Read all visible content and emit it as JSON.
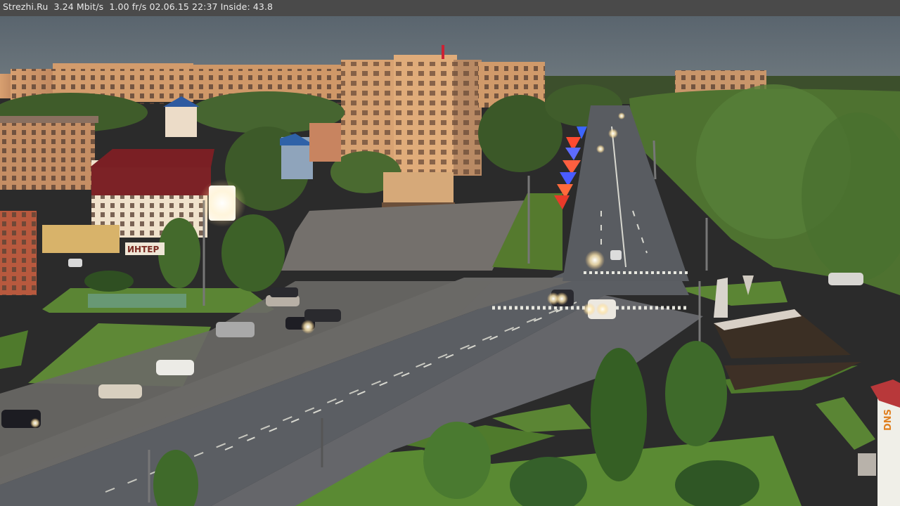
{
  "overlay": {
    "site": "Strezhi.Ru",
    "bitrate": "3.24 Mbit/s",
    "framerate": "1.00 fr/s",
    "datetime": "02.06.15 22:37",
    "inside_label": "Inside:",
    "inside_value": "43.8"
  },
  "signs": {
    "store_sign_fragment": "ИНТЕР",
    "right_banner_fragment": "DNS"
  },
  "colors": {
    "osd_bar": "#4a4a4a",
    "osd_text": "#e9e9e9",
    "sky": "#5f6870",
    "road": "#5a5c60",
    "grass": "#4f7a2c",
    "building_warm": "#d49a6a"
  }
}
